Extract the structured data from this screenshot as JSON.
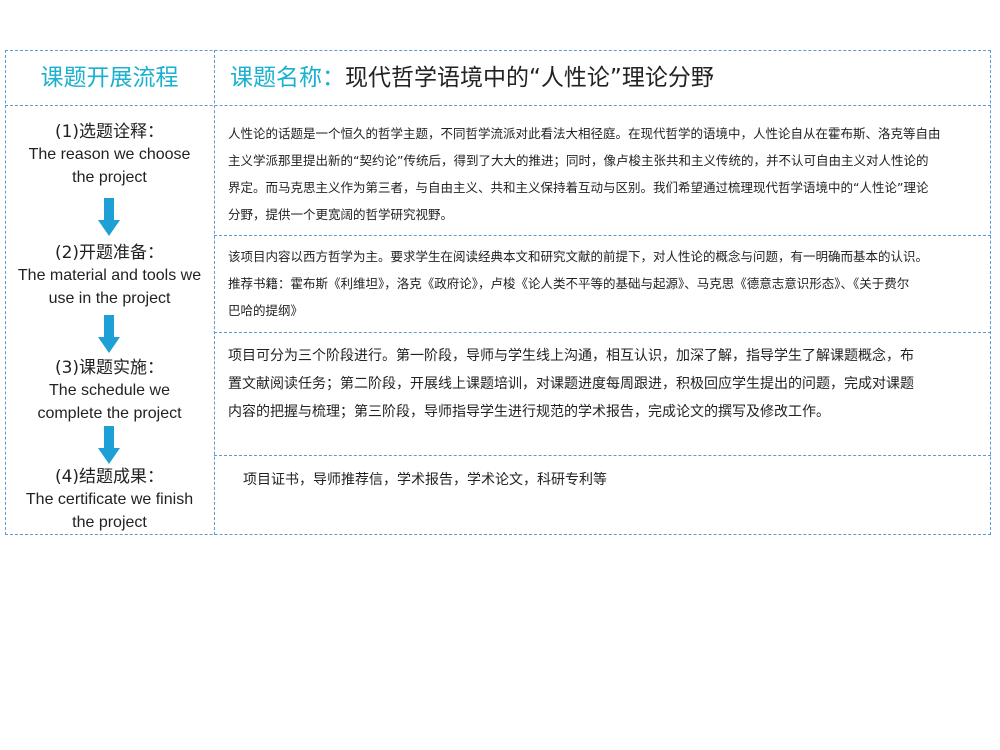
{
  "header": {
    "left_title": "课题开展流程",
    "right_label": "课题名称：",
    "right_title": "现代哲学语境中的“人性论”理论分野"
  },
  "steps": [
    {
      "cn": "(1)选题诠释：",
      "en": [
        "The reason we choose",
        "the project"
      ]
    },
    {
      "cn": "(2)开题准备：",
      "en": [
        "The material and tools we",
        "use in the project"
      ]
    },
    {
      "cn": "(3)课题实施：",
      "en": [
        "The schedule we",
        "complete the project"
      ]
    },
    {
      "cn": "(4)结题成果：",
      "en": [
        "The certificate we finish",
        "the project"
      ]
    }
  ],
  "sections": {
    "topic": {
      "lines": [
        "人性论的话题是一个恒久的哲学主题，不同哲学流派对此看法大相径庭。在现代哲学的语境中，人性论自从在霍布斯、洛克等自由",
        "主义学派那里提出新的“契约论”传统后，得到了大大的推进；同时，像卢梭主张共和主义传统的，并不认可自由主义对人性论的",
        "界定。而马克思主义作为第三者，与自由主义、共和主义保持着互动与区别。我们希望通过梳理现代哲学语境中的“人性论”理论",
        "分野，提供一个更宽阔的哲学研究视野。"
      ]
    },
    "preparation": {
      "lines": [
        "该项目内容以西方哲学为主。要求学生在阅读经典本文和研究文献的前提下，对人性论的概念与问题，有一明确而基本的认识。",
        "推荐书籍：霍布斯《利维坦》，洛克《政府论》，卢梭《论人类不平等的基础与起源》、马克思《德意志意识形态》、《关于费尔",
        "巴哈的提纲》"
      ]
    },
    "implementation": {
      "lines": [
        "项目可分为三个阶段进行。第一阶段，导师与学生线上沟通，相互认识，加深了解，指导学生了解课题概念，布",
        "置文献阅读任务；第二阶段，开展线上课题培训，对课题进度每周跟进，积极回应学生提出的问题，完成对课题",
        "内容的把握与梳理；第三阶段，导师指导学生进行规范的学术报告，完成论文的撰写及修改工作。"
      ]
    },
    "results": {
      "lines": [
        "项目证书，导师推荐信，学术报告，学术论文，科研专利等"
      ]
    }
  },
  "colors": {
    "accent": "#1ab0cf",
    "border": "#5a9bd5",
    "arrow": "#1e9fd6"
  }
}
